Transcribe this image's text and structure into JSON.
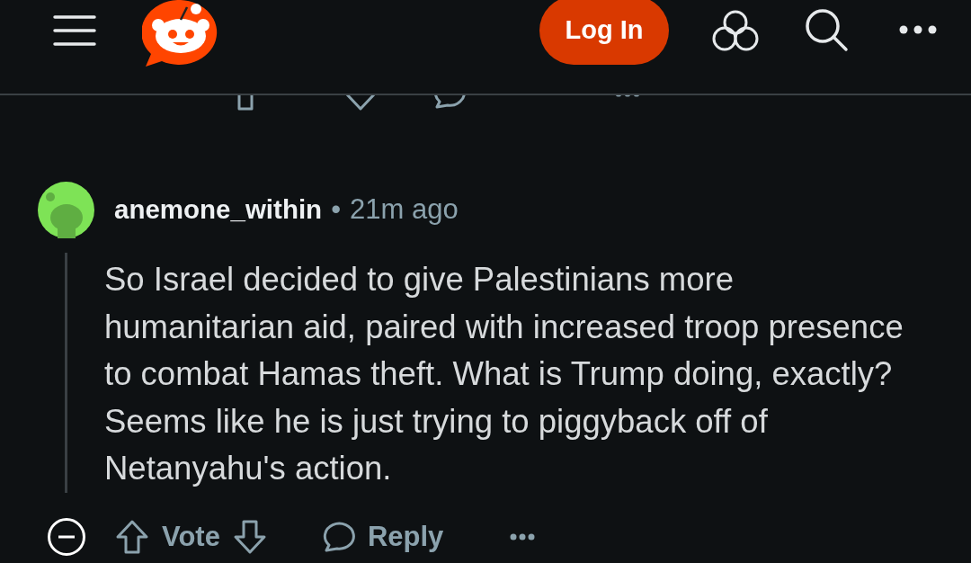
{
  "header": {
    "login_button": "Log In"
  },
  "comment": {
    "author": "anemone_within",
    "separator": "•",
    "time": "21m ago",
    "body": "So Israel decided to give Palestinians more humanitarian aid, paired with increased troop presence to combat Hamas theft. What is Trump doing, exactly? Seems like he is just trying to piggyback off of Netanyahu's action.",
    "actions": {
      "vote": "Vote",
      "reply": "Reply"
    }
  }
}
